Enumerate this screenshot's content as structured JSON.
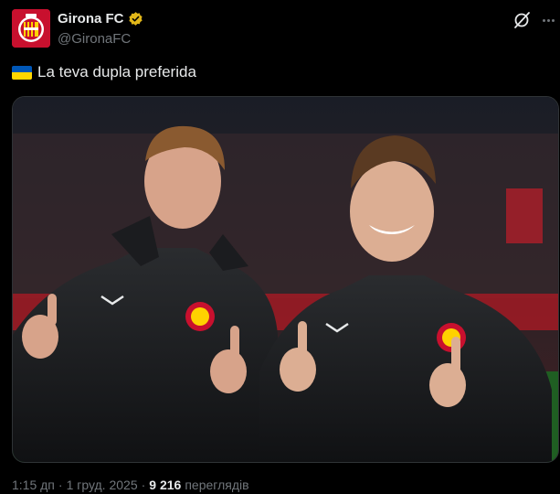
{
  "post": {
    "author": {
      "display_name": "Girona FC",
      "handle": "@GironaFC",
      "verified_badge": "gold-verified-icon"
    },
    "text": "La teva dupla preferida",
    "emoji": "ukraine-flag",
    "meta": {
      "time": "1:15 дп",
      "separator": "·",
      "date": "1 груд. 2025",
      "views_count": "9 216",
      "views_label": "переглядів"
    }
  },
  "colors": {
    "background": "#000000",
    "text_primary": "#e7e9ea",
    "text_secondary": "#71767b",
    "brand_red": "#c8102e",
    "verified_gold": "#e2b719"
  },
  "icons": [
    "girona-logo-icon",
    "gold-verified-icon",
    "grok-icon",
    "more-icon",
    "ukraine-flag-icon"
  ]
}
